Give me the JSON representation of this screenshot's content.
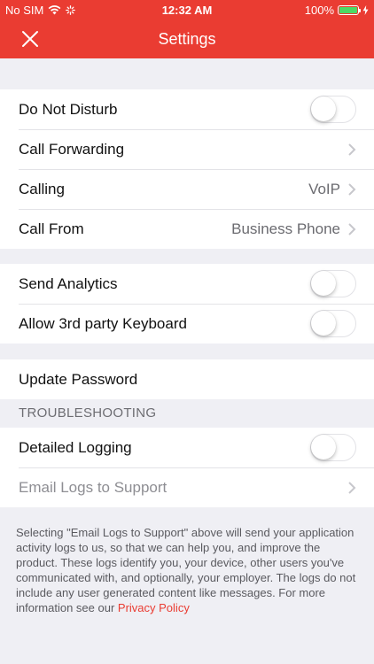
{
  "status_bar": {
    "carrier": "No SIM",
    "time": "12:32 AM",
    "battery": "100%",
    "battery_level": 1.0
  },
  "nav": {
    "title": "Settings",
    "close_icon": "close-icon"
  },
  "group1": {
    "do_not_disturb": {
      "label": "Do Not Disturb",
      "on": false
    },
    "call_forwarding": {
      "label": "Call Forwarding"
    },
    "calling": {
      "label": "Calling",
      "value": "VoIP"
    },
    "call_from": {
      "label": "Call From",
      "value": "Business Phone"
    }
  },
  "group2": {
    "send_analytics": {
      "label": "Send Analytics",
      "on": false
    },
    "third_party_keyboard": {
      "label": "Allow 3rd party Keyboard",
      "on": false
    }
  },
  "group3": {
    "update_password": {
      "label": "Update Password"
    }
  },
  "troubleshooting": {
    "header": "TROUBLESHOOTING",
    "detailed_logging": {
      "label": "Detailed Logging",
      "on": false
    },
    "email_logs": {
      "label": "Email Logs to Support"
    }
  },
  "footer": {
    "text": "Selecting \"Email Logs to Support\" above will send your application activity logs to us, so that we can help you, and improve the product. These logs identify you, your device, other users you've communicated with, and optionally, your employer. The logs do not include any user generated content like messages. For more information see our ",
    "link": "Privacy Policy"
  },
  "colors": {
    "accent": "#ea3c32",
    "background": "#efeff4",
    "battery_fill": "#4cd964"
  }
}
